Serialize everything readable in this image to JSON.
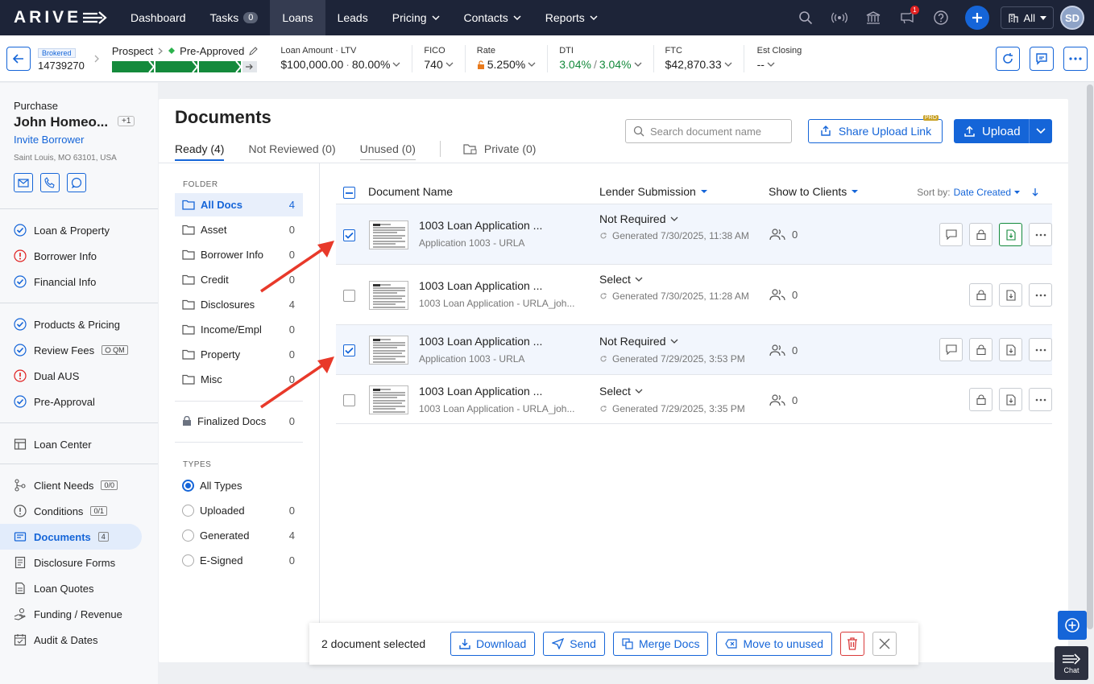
{
  "app": {
    "logo": "ARIVE"
  },
  "nav": {
    "items": [
      {
        "label": "Dashboard"
      },
      {
        "label": "Tasks",
        "badge": "0"
      },
      {
        "label": "Loans",
        "active": true
      },
      {
        "label": "Leads"
      },
      {
        "label": "Pricing",
        "dropdown": true
      },
      {
        "label": "Contacts",
        "dropdown": true
      },
      {
        "label": "Reports",
        "dropdown": true
      }
    ],
    "notification_count": "1",
    "scope_label": "All",
    "avatar_initials": "SD"
  },
  "loan": {
    "tag": "Brokered",
    "number": "14739270",
    "stage_from": "Prospect",
    "stage_to": "Pre-Approved",
    "amount_label": "Loan Amount · LTV",
    "amount_value": "$100,000.00",
    "ltv_value": "80.00%",
    "fico_label": "FICO",
    "fico_value": "740",
    "rate_label": "Rate",
    "rate_value": "5.250%",
    "dti_label": "DTI",
    "dti_front": "3.04%",
    "dti_sep": "/",
    "dti_back": "3.04%",
    "ftc_label": "FTC",
    "ftc_value": "$42,870.33",
    "closing_label": "Est Closing",
    "closing_value": "--"
  },
  "borrower": {
    "purpose": "Purchase",
    "name": "John Homeo...",
    "extra": "+1",
    "invite": "Invite Borrower",
    "address": "Saint Louis, MO 63101, USA"
  },
  "sidebar": {
    "group1": [
      {
        "label": "Loan & Property",
        "status": "ok"
      },
      {
        "label": "Borrower Info",
        "status": "warn"
      },
      {
        "label": "Financial Info",
        "status": "ok"
      }
    ],
    "group2": [
      {
        "label": "Products & Pricing",
        "status": "ok"
      },
      {
        "label": "Review Fees",
        "status": "ok",
        "badge": "QM"
      },
      {
        "label": "Dual AUS",
        "status": "warn"
      },
      {
        "label": "Pre-Approval",
        "status": "ok"
      }
    ],
    "loan_center": "Loan Center",
    "group3": [
      {
        "label": "Client Needs",
        "badge": "0/0"
      },
      {
        "label": "Conditions",
        "badge": "0/1"
      },
      {
        "label": "Documents",
        "badge": "4",
        "active": true
      },
      {
        "label": "Disclosure Forms"
      },
      {
        "label": "Loan Quotes"
      },
      {
        "label": "Funding / Revenue"
      },
      {
        "label": "Audit & Dates"
      }
    ]
  },
  "documents": {
    "title": "Documents",
    "tabs": [
      "Ready (4)",
      "Not Reviewed (0)",
      "Unused (0)",
      "Private (0)"
    ],
    "search_placeholder": "Search document name",
    "share_label": "Share Upload Link",
    "pro_label": "PRO",
    "upload_label": "Upload",
    "folder_label": "FOLDER",
    "folders": [
      {
        "name": "All Docs",
        "count": "4",
        "selected": true
      },
      {
        "name": "Asset",
        "count": "0"
      },
      {
        "name": "Borrower Info",
        "count": "0"
      },
      {
        "name": "Credit",
        "count": "0"
      },
      {
        "name": "Disclosures",
        "count": "4"
      },
      {
        "name": "Income/Empl",
        "count": "0"
      },
      {
        "name": "Property",
        "count": "0"
      },
      {
        "name": "Misc",
        "count": "0"
      }
    ],
    "finalized": {
      "name": "Finalized Docs",
      "count": "0"
    },
    "types_label": "TYPES",
    "types": [
      {
        "name": "All Types",
        "count": "",
        "selected": true
      },
      {
        "name": "Uploaded",
        "count": "0"
      },
      {
        "name": "Generated",
        "count": "4"
      },
      {
        "name": "E-Signed",
        "count": "0"
      }
    ],
    "columns": {
      "name": "Document Name",
      "lender": "Lender Submission",
      "clients": "Show to Clients",
      "sort_label": "Sort by:",
      "sort_value": "Date Created"
    },
    "rows": [
      {
        "title": "1003 Loan Application ...",
        "subtitle": "Application 1003 - URLA",
        "lender": "Not Required",
        "generated": "Generated 7/30/2025, 11:38 AM",
        "clients": "0",
        "checked": true
      },
      {
        "title": "1003 Loan Application ...",
        "subtitle": "1003 Loan Application - URLA_joh...",
        "lender": "Select",
        "generated": "Generated 7/30/2025, 11:28 AM",
        "clients": "0",
        "checked": false
      },
      {
        "title": "1003 Loan Application ...",
        "subtitle": "Application 1003 - URLA",
        "lender": "Not Required",
        "generated": "Generated 7/29/2025, 3:53 PM",
        "clients": "0",
        "checked": true
      },
      {
        "title": "1003 Loan Application ...",
        "subtitle": "1003 Loan Application - URLA_joh...",
        "lender": "Select",
        "generated": "Generated 7/29/2025, 3:35 PM",
        "clients": "0",
        "checked": false
      }
    ]
  },
  "actionbar": {
    "count_label": "2 document selected",
    "download": "Download",
    "send": "Send",
    "merge": "Merge Docs",
    "move": "Move to unused"
  },
  "chat_label": "Chat",
  "colors": {
    "accent": "#1565d8",
    "nav_bg": "#1d2438",
    "success": "#148a3c",
    "danger": "#e02020",
    "annotation": "#e8392a"
  }
}
